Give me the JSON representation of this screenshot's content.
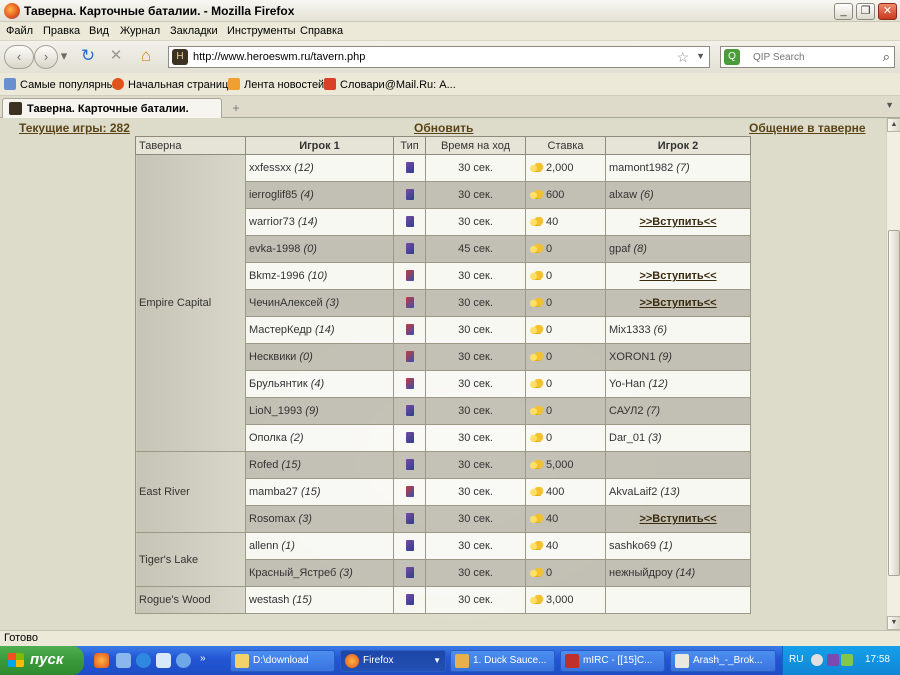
{
  "window": {
    "title": "Таверна. Карточные баталии. - Mozilla Firefox",
    "minimize": "_",
    "restore": "❐",
    "close": "✕"
  },
  "menu": [
    "Файл",
    "Правка",
    "Вид",
    "Журнал",
    "Закладки",
    "Инструменты",
    "Справка"
  ],
  "nav": {
    "back": "‹",
    "forward": "›",
    "history_dropdown": "▾",
    "reload": "↻",
    "stop": "✕",
    "home": "⌂",
    "url": "http://www.heroeswm.ru/tavern.php",
    "search_placeholder": "QIP Search"
  },
  "bookmarks": [
    "Самые популярные",
    "Начальная страница",
    "Лента новостей",
    "Словари@Mail.Ru: А..."
  ],
  "tab": {
    "label": "Таверна. Карточные баталии.",
    "new_tab": "+"
  },
  "page": {
    "current_games": "Текущие игры: 282",
    "refresh": "Обновить",
    "chat": "Общение в таверне",
    "headers": [
      "Таверна",
      "Игрок 1",
      "Тип",
      "Время на ход",
      "Ставка",
      "Игрок 2"
    ],
    "regions": [
      {
        "name": "Empire Capital",
        "rows": [
          {
            "p1": "xxfessxx",
            "l1": "(12)",
            "type": "a",
            "time": "30 сек.",
            "bet": "2,000",
            "p2": "mamont1982",
            "l2": "(7)"
          },
          {
            "p1": "ierroglif85",
            "l1": "(4)",
            "type": "a",
            "time": "30 сек.",
            "bet": "600",
            "p2": "alxaw",
            "l2": "(6)"
          },
          {
            "p1": "warrior73",
            "l1": "(14)",
            "type": "a",
            "time": "30 сек.",
            "bet": "40",
            "join": ">>Вступить<<"
          },
          {
            "p1": "evka-1998",
            "l1": "(0)",
            "type": "a",
            "time": "45 сек.",
            "bet": "0",
            "p2": "gpaf",
            "l2": "(8)"
          },
          {
            "p1": "Bkmz-1996",
            "l1": "(10)",
            "type": "b",
            "time": "30 сек.",
            "bet": "0",
            "join": ">>Вступить<<"
          },
          {
            "p1": "ЧечинАлексей",
            "l1": "(3)",
            "type": "b",
            "time": "30 сек.",
            "bet": "0",
            "join": ">>Вступить<<"
          },
          {
            "p1": "МастерКедр",
            "l1": "(14)",
            "type": "b",
            "time": "30 сек.",
            "bet": "0",
            "p2": "Mix1333",
            "l2": "(6)"
          },
          {
            "p1": "Несквики",
            "l1": "(0)",
            "type": "b",
            "time": "30 сек.",
            "bet": "0",
            "p2": "XORON1",
            "l2": "(9)"
          },
          {
            "p1": "Брульянтик",
            "l1": "(4)",
            "type": "b",
            "time": "30 сек.",
            "bet": "0",
            "p2": "Yo-Han",
            "l2": "(12)"
          },
          {
            "p1": "LioN_1993",
            "l1": "(9)",
            "type": "a",
            "time": "30 сек.",
            "bet": "0",
            "p2": "САУЛ2",
            "l2": "(7)"
          },
          {
            "p1": "Ополка",
            "l1": "(2)",
            "type": "a",
            "time": "30 сек.",
            "bet": "0",
            "p2": "Dar_01",
            "l2": "(3)"
          }
        ]
      },
      {
        "name": "East River",
        "rows": [
          {
            "p1": "Rofed",
            "l1": "(15)",
            "type": "a",
            "time": "30 сек.",
            "bet": "5,000"
          },
          {
            "p1": "mamba27",
            "l1": "(15)",
            "type": "b",
            "time": "30 сек.",
            "bet": "400",
            "p2": "AkvaLaif2",
            "l2": "(13)"
          },
          {
            "p1": "Rosomax",
            "l1": "(3)",
            "type": "a",
            "time": "30 сек.",
            "bet": "40",
            "join": ">>Вступить<<"
          }
        ]
      },
      {
        "name": "Tiger's Lake",
        "rows": [
          {
            "p1": "allenn",
            "l1": "(1)",
            "type": "a",
            "time": "30 сек.",
            "bet": "40",
            "p2": "sashko69",
            "l2": "(1)"
          },
          {
            "p1": "Красный_Ястреб",
            "l1": "(3)",
            "type": "a",
            "time": "30 сек.",
            "bet": "0",
            "p2": "нежныйдроу",
            "l2": "(14)"
          }
        ]
      },
      {
        "name": "Rogue's Wood",
        "rows": [
          {
            "p1": "westash",
            "l1": "(15)",
            "type": "a",
            "time": "30 сек.",
            "bet": "3,000"
          }
        ]
      }
    ]
  },
  "status": "Готово",
  "taskbar": {
    "start": "пуск",
    "tasks": [
      "D:\\download",
      "Firefox",
      "1. Duck Sauce...",
      "mIRC - [[15]C...",
      "Arash_-_Brok..."
    ],
    "lang": "RU",
    "clock": "17:58"
  },
  "colors": {
    "link": "#5a4316",
    "taskbar": "#2457d6",
    "start": "#3a9a3a"
  }
}
